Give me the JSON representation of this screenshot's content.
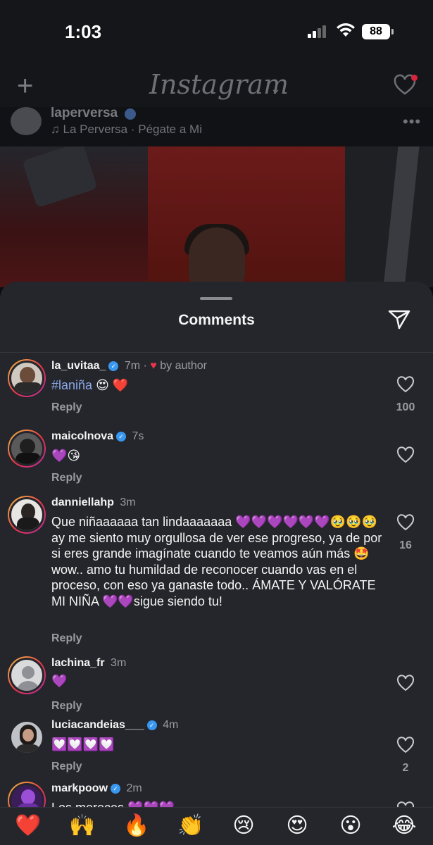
{
  "status": {
    "time": "1:03",
    "battery": "88"
  },
  "topbar": {
    "logo": "Instagram",
    "chevron": "⌄"
  },
  "post": {
    "username": "laperversa",
    "song": "La Perversa · Pégate a Mi",
    "more": "•••"
  },
  "sheet": {
    "title": "Comments"
  },
  "comments": [
    {
      "username": "la_uvitaa_",
      "time": "7m ·",
      "by_author": "by author",
      "text_tag": "#laniña",
      "text_emoji": " 😍 ❤️",
      "reply": "Reply",
      "likes": "100"
    },
    {
      "username": "maicolnova",
      "time": "7s",
      "text": "💜😘",
      "reply": "Reply",
      "likes": ""
    },
    {
      "username": "danniellahp",
      "time": "3m",
      "text": "Que niñaaaaaa tan lindaaaaaaa 💜💜💜💜💜💜🥹🥹🥹 ay me siento muy orgullosa de ver ese progreso, ya de por si eres grande imagínate cuando te veamos aún más 🤩 wow.. amo tu humildad de reconocer cuando vas en el proceso, con eso ya ganaste todo.. ÁMATE Y VALÓRATE MI NIÑA 💜💜sigue siendo tu!",
      "reply": "Reply",
      "likes": "16"
    },
    {
      "username": "lachina_fr",
      "time": "3m",
      "text": "💜",
      "reply": "Reply",
      "likes": ""
    },
    {
      "username": "luciacandeias___",
      "time": "4m",
      "text": "💟💟💟💟",
      "reply": "Reply",
      "likes": "2"
    },
    {
      "username": "markpoow",
      "time": "2m",
      "text": "Los mereces 💜💜💜",
      "reply": "",
      "likes": ""
    }
  ],
  "emoji_bar": [
    "❤️",
    "🙌",
    "🔥",
    "👏",
    "😢",
    "😍",
    "😮",
    "😂"
  ],
  "colors": {
    "background": "#25262b",
    "hashtag": "#8aa8e8",
    "verified": "#3897f0",
    "notification": "#d8243b"
  }
}
